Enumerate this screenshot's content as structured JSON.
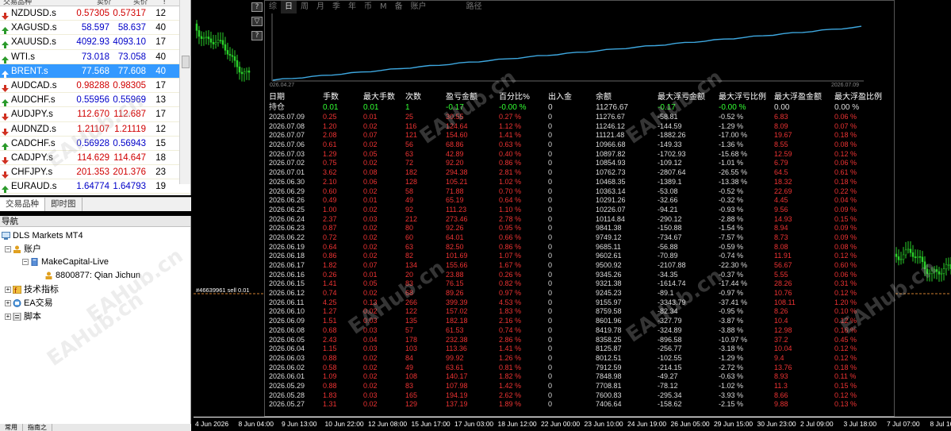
{
  "market_watch": {
    "headers": [
      "交易品种",
      "卖价",
      "买价",
      "!"
    ],
    "rows": [
      {
        "symbol": "NZDUSD.s",
        "bid": "0.57305",
        "ask": "0.57317",
        "spread": "12",
        "dir": "dn"
      },
      {
        "symbol": "XAGUSD.s",
        "bid": "58.597",
        "ask": "58.637",
        "spread": "40",
        "dir": "up"
      },
      {
        "symbol": "XAUUSD.s",
        "bid": "4092.93",
        "ask": "4093.10",
        "spread": "17",
        "dir": "up"
      },
      {
        "symbol": "WTI.s",
        "bid": "73.018",
        "ask": "73.058",
        "spread": "40",
        "dir": "up"
      },
      {
        "symbol": "BRENT.s",
        "bid": "77.568",
        "ask": "77.608",
        "spread": "40",
        "dir": "sel"
      },
      {
        "symbol": "AUDCAD.s",
        "bid": "0.98288",
        "ask": "0.98305",
        "spread": "17",
        "dir": "dn"
      },
      {
        "symbol": "AUDCHF.s",
        "bid": "0.55956",
        "ask": "0.55969",
        "spread": "13",
        "dir": "up"
      },
      {
        "symbol": "AUDJPY.s",
        "bid": "112.670",
        "ask": "112.687",
        "spread": "17",
        "dir": "dn"
      },
      {
        "symbol": "AUDNZD.s",
        "bid": "1.21107",
        "ask": "1.21119",
        "spread": "12",
        "dir": "dn"
      },
      {
        "symbol": "CADCHF.s",
        "bid": "0.56928",
        "ask": "0.56943",
        "spread": "15",
        "dir": "up"
      },
      {
        "symbol": "CADJPY.s",
        "bid": "114.629",
        "ask": "114.647",
        "spread": "18",
        "dir": "dn"
      },
      {
        "symbol": "CHFJPY.s",
        "bid": "201.353",
        "ask": "201.376",
        "spread": "23",
        "dir": "dn"
      },
      {
        "symbol": "EURAUD.s",
        "bid": "1.64774",
        "ask": "1.64793",
        "spread": "19",
        "dir": "up"
      }
    ],
    "tabs": [
      "交易品种",
      "即时图"
    ]
  },
  "navigator": {
    "title": "导航",
    "items": [
      "DLS Markets MT4",
      "账户",
      "MakeCapital-Live",
      "8800877: Qian Jichun",
      "技术指标",
      "EA交易",
      "脚本"
    ]
  },
  "bottom_tabs": [
    "常用",
    "指南之"
  ],
  "chart": {
    "price_tag": "#46639961 sell 0.01",
    "x_labels": [
      "4 Jun 2026",
      "8 Jun 04:00",
      "9 Jun 13:00",
      "10 Jun 22:00",
      "12 Jun 08:00",
      "15 Jun 17:00",
      "17 Jun 03:00",
      "18 Jun 12:00",
      "22 Jun 00:00",
      "23 Jun 10:00",
      "24 Jun 19:00",
      "26 Jun 05:00",
      "29 Jun 15:00",
      "30 Jun 23:00",
      "2 Jul 09:00",
      "3 Jul 18:00",
      "7 Jul 07:00",
      "8 Jul 16:00"
    ],
    "side_buttons": [
      "?",
      "▽",
      "?"
    ]
  },
  "report": {
    "tabs": [
      "综",
      "日",
      "周",
      "月",
      "季",
      "年",
      "币",
      "M",
      "备",
      "账户",
      "",
      "路径"
    ],
    "active_tab": "日",
    "equity_curve": [
      0,
      1,
      2,
      3,
      4,
      5,
      6,
      7,
      8,
      9,
      10,
      11,
      12,
      13,
      14,
      15,
      16,
      17,
      18,
      19,
      20,
      21,
      22,
      23,
      24,
      25,
      26,
      27,
      28,
      29,
      30,
      31,
      32,
      33,
      34,
      35,
      36,
      37,
      38,
      39,
      40,
      41,
      42,
      43,
      44,
      45,
      46,
      47,
      48,
      49,
      50,
      51,
      52,
      53,
      54,
      55,
      56,
      57,
      58,
      59,
      60
    ],
    "eq_start": "026.04.27",
    "eq_end": "2026.07.09",
    "columns": [
      "日期",
      "手数",
      "最大手数",
      "次数",
      "盈亏金额",
      "百分比%",
      "出入金",
      "余额",
      "最大浮亏金额",
      "最大浮亏比例",
      "最大浮盈金额",
      "最大浮盈比例"
    ],
    "holding": [
      "持仓",
      "0.01",
      "0.01",
      "1",
      "-0.17",
      "-0.00 %",
      "0",
      "11276.67",
      "-0.17",
      "-0.00 %",
      "0.00",
      "0.00 %"
    ],
    "rows": [
      [
        "2026.07.09",
        "0.25",
        "0.01",
        "25",
        "30.55",
        "0.27 %",
        "0",
        "11276.67",
        "-58.81",
        "-0.52 %",
        "6.83",
        "0.06 %"
      ],
      [
        "2026.07.08",
        "1.20",
        "0.02",
        "116",
        "124.64",
        "1.12 %",
        "0",
        "11246.12",
        "-144.59",
        "-1.29 %",
        "8.09",
        "0.07 %"
      ],
      [
        "2026.07.07",
        "2.08",
        "0.07",
        "121",
        "154.60",
        "1.41 %",
        "0",
        "11121.48",
        "-1882.26",
        "-17.00 %",
        "19.67",
        "0.18 %"
      ],
      [
        "2026.07.06",
        "0.61",
        "0.02",
        "56",
        "68.86",
        "0.63 %",
        "0",
        "10966.68",
        "-149.33",
        "-1.36 %",
        "8.55",
        "0.08 %"
      ],
      [
        "2026.07.03",
        "1.29",
        "0.05",
        "63",
        "42.89",
        "0.40 %",
        "0",
        "10897.82",
        "-1702.93",
        "-15.68 %",
        "12.59",
        "0.12 %"
      ],
      [
        "2026.07.02",
        "0.75",
        "0.02",
        "72",
        "92.20",
        "0.86 %",
        "0",
        "10854.93",
        "-109.12",
        "-1.01 %",
        "6.79",
        "0.06 %"
      ],
      [
        "2026.07.01",
        "3.62",
        "0.08",
        "182",
        "294.38",
        "2.81 %",
        "0",
        "10762.73",
        "-2807.64",
        "-26.55 %",
        "64.5",
        "0.61 %"
      ],
      [
        "2026.06.30",
        "2.10",
        "0.06",
        "128",
        "105.21",
        "1.02 %",
        "0",
        "10468.35",
        "-1389.1",
        "-13.38 %",
        "18.32",
        "0.18 %"
      ],
      [
        "2026.06.29",
        "0.60",
        "0.02",
        "58",
        "71.88",
        "0.70 %",
        "0",
        "10363.14",
        "-53.08",
        "-0.52 %",
        "22.69",
        "0.22 %"
      ],
      [
        "2026.06.26",
        "0.49",
        "0.01",
        "49",
        "65.19",
        "0.64 %",
        "0",
        "10291.26",
        "-32.66",
        "-0.32 %",
        "4.45",
        "0.04 %"
      ],
      [
        "2026.06.25",
        "1.00",
        "0.02",
        "92",
        "111.23",
        "1.10 %",
        "0",
        "10226.07",
        "-94.21",
        "-0.93 %",
        "9.56",
        "0.09 %"
      ],
      [
        "2026.06.24",
        "2.37",
        "0.03",
        "212",
        "273.46",
        "2.78 %",
        "0",
        "10114.84",
        "-290.12",
        "-2.88 %",
        "14.93",
        "0.15 %"
      ],
      [
        "2026.06.23",
        "0.87",
        "0.02",
        "80",
        "92.26",
        "0.95 %",
        "0",
        "9841.38",
        "-150.88",
        "-1.54 %",
        "8.94",
        "0.09 %"
      ],
      [
        "2026.06.22",
        "0.72",
        "0.02",
        "60",
        "64.01",
        "0.66 %",
        "0",
        "9749.12",
        "-734.67",
        "-7.57 %",
        "8.73",
        "0.09 %"
      ],
      [
        "2026.06.19",
        "0.64",
        "0.02",
        "63",
        "82.50",
        "0.86 %",
        "0",
        "9685.11",
        "-56.88",
        "-0.59 %",
        "8.08",
        "0.08 %"
      ],
      [
        "2026.06.18",
        "0.86",
        "0.02",
        "82",
        "101.69",
        "1.07 %",
        "0",
        "9602.61",
        "-70.89",
        "-0.74 %",
        "11.91",
        "0.12 %"
      ],
      [
        "2026.06.17",
        "1.82",
        "0.07",
        "134",
        "155.66",
        "1.67 %",
        "0",
        "9500.92",
        "-2107.88",
        "-22.30 %",
        "56.67",
        "0.60 %"
      ],
      [
        "2026.06.16",
        "0.26",
        "0.01",
        "20",
        "23.88",
        "0.26 %",
        "0",
        "9345.26",
        "-34.35",
        "-0.37 %",
        "5.55",
        "0.06 %"
      ],
      [
        "2026.06.15",
        "1.41",
        "0.05",
        "83",
        "76.15",
        "0.82 %",
        "0",
        "9321.38",
        "-1614.74",
        "-17.44 %",
        "28.26",
        "0.31 %"
      ],
      [
        "2026.06.12",
        "0.74",
        "0.02",
        "68",
        "89.26",
        "0.97 %",
        "0",
        "9245.23",
        "-89.1",
        "-0.97 %",
        "10.76",
        "0.12 %"
      ],
      [
        "2026.06.11",
        "4.25",
        "0.13",
        "266",
        "399.39",
        "4.53 %",
        "0",
        "9155.97",
        "-3343.79",
        "-37.41 %",
        "108.11",
        "1.20 %"
      ],
      [
        "2026.06.10",
        "1.27",
        "0.02",
        "122",
        "157.02",
        "1.83 %",
        "0",
        "8759.58",
        "-82.34",
        "-0.95 %",
        "8.26",
        "0.10 %"
      ],
      [
        "2026.06.09",
        "1.51",
        "0.03",
        "135",
        "182.18",
        "2.16 %",
        "0",
        "8601.96",
        "-327.79",
        "-3.87 %",
        "10.4",
        "0.12 %"
      ],
      [
        "2026.06.08",
        "0.68",
        "0.03",
        "57",
        "61.53",
        "0.74 %",
        "0",
        "8419.78",
        "-324.89",
        "-3.88 %",
        "12.98",
        "0.16 %"
      ],
      [
        "2026.06.05",
        "2.43",
        "0.04",
        "178",
        "232.38",
        "2.86 %",
        "0",
        "8358.25",
        "-896.58",
        "-10.97 %",
        "37.2",
        "0.45 %"
      ],
      [
        "2026.06.04",
        "1.15",
        "0.03",
        "103",
        "113.36",
        "1.41 %",
        "0",
        "8125.87",
        "-256.77",
        "-3.18 %",
        "10.04",
        "0.12 %"
      ],
      [
        "2026.06.03",
        "0.88",
        "0.02",
        "84",
        "99.92",
        "1.26 %",
        "0",
        "8012.51",
        "-102.55",
        "-1.29 %",
        "9.4",
        "0.12 %"
      ],
      [
        "2026.06.02",
        "0.58",
        "0.02",
        "49",
        "63.61",
        "0.81 %",
        "0",
        "7912.59",
        "-214.15",
        "-2.72 %",
        "13.76",
        "0.18 %"
      ],
      [
        "2026.06.01",
        "1.09",
        "0.02",
        "108",
        "140.17",
        "1.82 %",
        "0",
        "7848.98",
        "-49.27",
        "-0.63 %",
        "8.93",
        "0.11 %"
      ],
      [
        "2026.05.29",
        "0.88",
        "0.02",
        "83",
        "107.98",
        "1.42 %",
        "0",
        "7708.81",
        "-78.12",
        "-1.02 %",
        "11.3",
        "0.15 %"
      ],
      [
        "2026.05.28",
        "1.83",
        "0.03",
        "165",
        "194.19",
        "2.62 %",
        "0",
        "7600.83",
        "-295.34",
        "-3.93 %",
        "8.66",
        "0.12 %"
      ],
      [
        "2026.05.27",
        "1.31",
        "0.02",
        "129",
        "137.19",
        "1.89 %",
        "0",
        "7406.64",
        "-158.62",
        "-2.15 %",
        "9.88",
        "0.13 %"
      ]
    ]
  },
  "watermark": "EAHub.cn",
  "colors": {
    "profit": "#e33333",
    "holding": "#33ff33",
    "equity_line": "#3ea8e0",
    "selected": "#3399ff"
  }
}
